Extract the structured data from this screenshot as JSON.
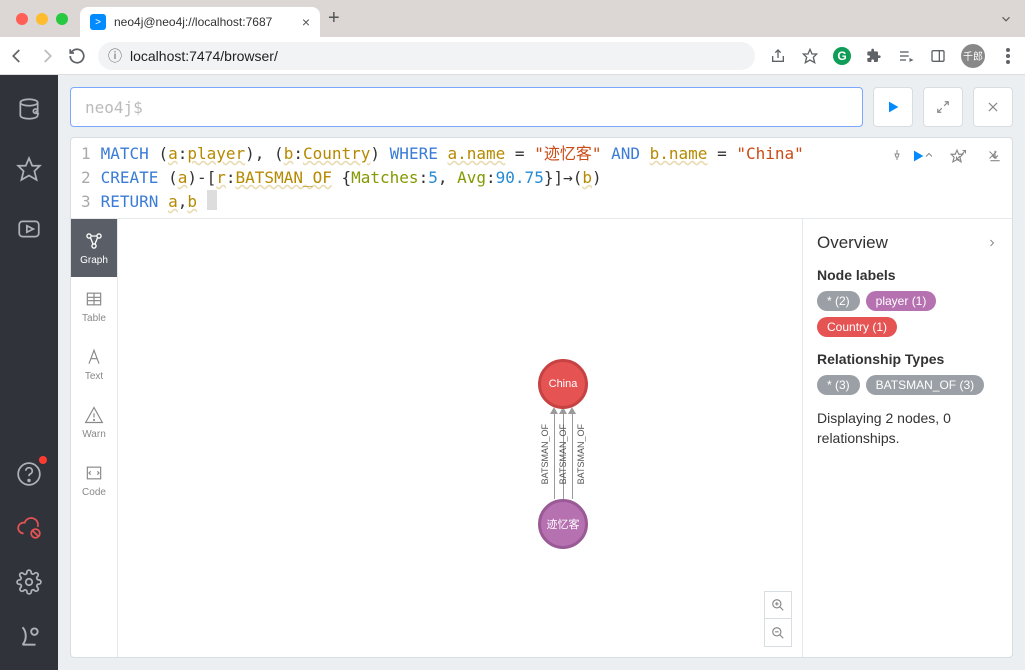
{
  "browser": {
    "tab_title": "neo4j@neo4j://localhost:7687",
    "url": "localhost:7474/browser/",
    "avatar": "千郎"
  },
  "query_bar": {
    "prompt": "neo4j$"
  },
  "editor": {
    "lines": [
      "1",
      "2",
      "3"
    ],
    "line1": {
      "kw1": "MATCH",
      "p1": " (",
      "v1": "a",
      "c": ":",
      "lbl1": "player",
      "p2": "), (",
      "v2": "b",
      "lbl2": "Country",
      "p3": ") ",
      "kw2": "WHERE",
      "sp": " ",
      "e1": "a.name",
      "eq": " = ",
      "s1": "\"迹忆客\"",
      "and": " AND ",
      "e2": "b.name",
      "s2": "\"China\""
    },
    "line2": {
      "kw": "CREATE",
      "p1": " (",
      "v1": "a",
      "p2": ")-[",
      "v2": "r",
      "c": ":",
      "lbl": "BATSMAN_OF",
      "p3": " {",
      "prop1": "Matches",
      "c2": ":",
      "n1": "5",
      "cm": ", ",
      "prop2": "Avg",
      "n2": "90.75",
      "p4": "}]→(",
      "v3": "b",
      "p5": ")"
    },
    "line3": {
      "kw": "RETURN",
      "sp": " ",
      "v1": "a",
      "cm": ",",
      "v2": "b"
    }
  },
  "view_tabs": {
    "graph": "Graph",
    "table": "Table",
    "text": "Text",
    "warn": "Warn",
    "code": "Code"
  },
  "graph": {
    "node_china": "China",
    "node_player": "迹忆客",
    "rel": "BATSMAN_OF"
  },
  "overview": {
    "title": "Overview",
    "node_labels_h": "Node labels",
    "chips_nodes": [
      {
        "txt": "* (2)",
        "cls": "grey"
      },
      {
        "txt": "player (1)",
        "cls": "pink"
      },
      {
        "txt": "Country (1)",
        "cls": "red"
      }
    ],
    "rel_types_h": "Relationship Types",
    "chips_rels": [
      {
        "txt": "* (3)",
        "cls": "grey"
      },
      {
        "txt": "BATSMAN_OF (3)",
        "cls": "grey"
      }
    ],
    "footer": "Displaying 2 nodes, 0 relationships."
  }
}
